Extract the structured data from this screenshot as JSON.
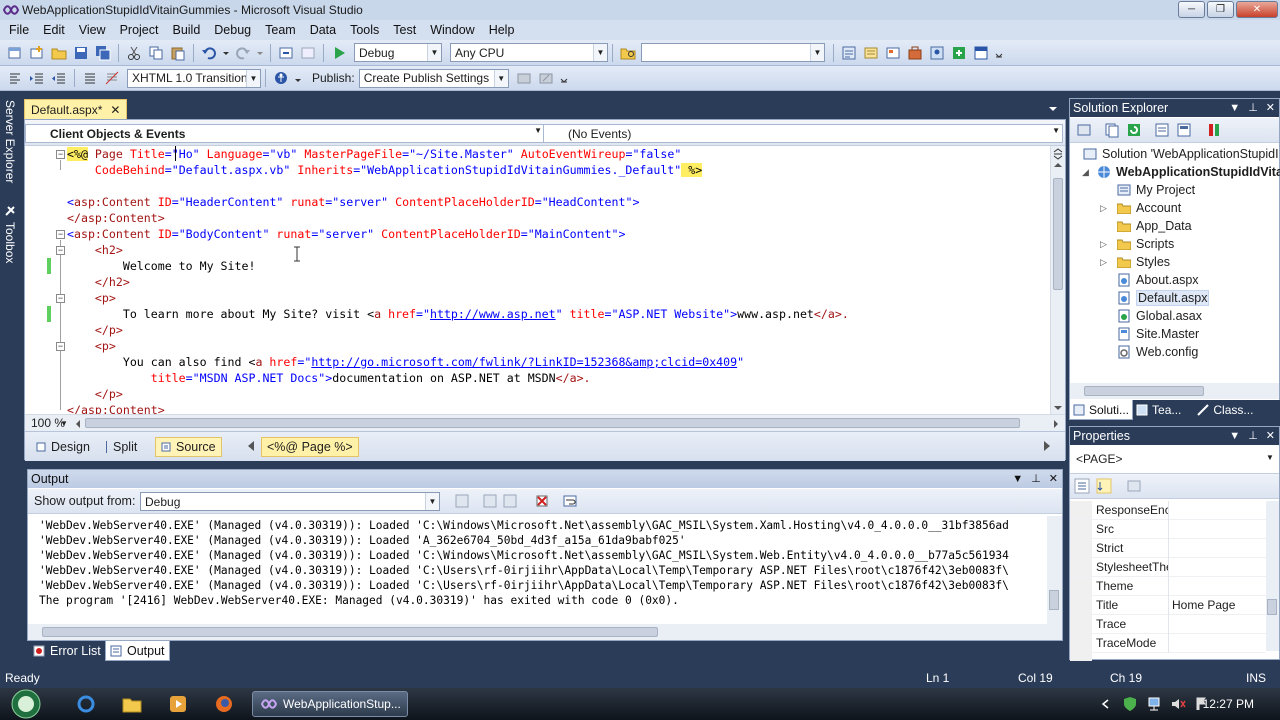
{
  "window": {
    "title": "WebApplicationStupidIdVitainGummies - Microsoft Visual Studio"
  },
  "menu": [
    "File",
    "Edit",
    "View",
    "Project",
    "Build",
    "Debug",
    "Team",
    "Data",
    "Tools",
    "Test",
    "Window",
    "Help"
  ],
  "toolbar1": {
    "config": "Debug",
    "platform": "Any CPU",
    "find_value": ""
  },
  "toolbar2": {
    "doctype": "XHTML 1.0 Transition",
    "publish_label": "Publish:",
    "publish_value": "Create Publish Settings"
  },
  "side_tabs": [
    "Server Explorer",
    "Toolbox"
  ],
  "editor": {
    "tab_label": "Default.aspx*",
    "nav_left": "Client Objects & Events",
    "nav_right": "(No Events)",
    "zoom": "100 %",
    "view_buttons": [
      "Design",
      "Split",
      "Source"
    ],
    "breadcrumb": "<%@ Page %>",
    "lines": {
      "l1a": "<%@",
      "l1b": " Page ",
      "l1c": "Title",
      "l1d": "=",
      "l1e": "\"Ho\"",
      "l1f": " Language",
      "l1g": "=\"vb\"",
      "l1h": " MasterPageFile",
      "l1i": "=\"~/Site.Master\"",
      "l1j": " AutoEventWireup",
      "l1k": "=\"false\"",
      "l2a": "    CodeBehind",
      "l2b": "=\"Default.aspx.vb\"",
      "l2c": " Inherits",
      "l2d": "=\"WebApplicationStupidIdVitainGummies._Default\"",
      "l2e": " %>",
      "l3a": "<",
      "l3b": "asp:Content",
      "l3c": " ID",
      "l3d": "=\"HeaderContent\"",
      "l3e": " runat",
      "l3f": "=\"server\"",
      "l3g": " ContentPlaceHolderID",
      "l3h": "=\"HeadContent\">",
      "l4": "</asp:Content>",
      "l5a": "<",
      "l5b": "asp:Content",
      "l5c": " ID",
      "l5d": "=\"BodyContent\"",
      "l5e": " runat",
      "l5f": "=\"server\"",
      "l5g": " ContentPlaceHolderID",
      "l5h": "=\"MainContent\">",
      "l6": "    <h2>",
      "l7": "        Welcome to My Site!",
      "l8": "    </h2>",
      "l9": "    <p>",
      "l10a": "        To learn more about My Site? visit <",
      "l10b": "a",
      "l10c": " href",
      "l10d": "=\"",
      "l10e": "http://www.asp.net",
      "l10f": "\"",
      "l10g": " title",
      "l10h": "=\"ASP.NET Website\">",
      "l10i": "www.asp.net",
      "l10j": "</a>.",
      "l11": "    </p>",
      "l12": "    <p>",
      "l13a": "        You can also find <",
      "l13b": "a",
      "l13c": " href",
      "l13d": "=\"",
      "l13e": "http://go.microsoft.com/fwlink/?LinkID=152368&amp;clcid=0x409",
      "l13f": "\"",
      "l14a": "            title",
      "l14b": "=\"MSDN ASP.NET Docs\">",
      "l14c": "documentation on ASP.NET at MSDN",
      "l14d": "</a>.",
      "l15": "    </p>",
      "l16": "</asp:Content>"
    }
  },
  "output": {
    "title": "Output",
    "show_from_label": "Show output from:",
    "show_from_value": "Debug",
    "lines": [
      "'WebDev.WebServer40.EXE' (Managed (v4.0.30319)): Loaded 'C:\\Windows\\Microsoft.Net\\assembly\\GAC_MSIL\\System.Xaml.Hosting\\v4.0_4.0.0.0__31bf3856ad",
      "'WebDev.WebServer40.EXE' (Managed (v4.0.30319)): Loaded 'A_362e6704_50bd_4d3f_a15a_61da9babf025'",
      "'WebDev.WebServer40.EXE' (Managed (v4.0.30319)): Loaded 'C:\\Windows\\Microsoft.Net\\assembly\\GAC_MSIL\\System.Web.Entity\\v4.0_4.0.0.0__b77a5c561934",
      "'WebDev.WebServer40.EXE' (Managed (v4.0.30319)): Loaded 'C:\\Users\\rf-0irjiihr\\AppData\\Local\\Temp\\Temporary ASP.NET Files\\root\\c1876f42\\3eb0083f\\",
      "'WebDev.WebServer40.EXE' (Managed (v4.0.30319)): Loaded 'C:\\Users\\rf-0irjiihr\\AppData\\Local\\Temp\\Temporary ASP.NET Files\\root\\c1876f42\\3eb0083f\\",
      "The program '[2416] WebDev.WebServer40.EXE: Managed (v4.0.30319)' has exited with code 0 (0x0)."
    ],
    "tabs": [
      "Error List",
      "Output"
    ]
  },
  "solution": {
    "title": "Solution Explorer",
    "root": "Solution 'WebApplicationStupidI",
    "project": "WebApplicationStupidIdVita",
    "items": [
      "My Project",
      "Account",
      "App_Data",
      "Scripts",
      "Styles",
      "About.aspx",
      "Default.aspx",
      "Global.asax",
      "Site.Master",
      "Web.config"
    ],
    "tabs": [
      "Soluti...",
      "Tea...",
      "Class..."
    ]
  },
  "properties": {
    "title": "Properties",
    "object": "<PAGE>",
    "rows": [
      {
        "k": "ResponseEnco",
        "v": ""
      },
      {
        "k": "Src",
        "v": ""
      },
      {
        "k": "Strict",
        "v": ""
      },
      {
        "k": "StylesheetThe",
        "v": ""
      },
      {
        "k": "Theme",
        "v": ""
      },
      {
        "k": "Title",
        "v": "Home Page"
      },
      {
        "k": "Trace",
        "v": ""
      },
      {
        "k": "TraceMode",
        "v": ""
      }
    ]
  },
  "status": {
    "ready": "Ready",
    "ln": "Ln 1",
    "col": "Col 19",
    "ch": "Ch 19",
    "ins": "INS"
  },
  "taskbar": {
    "task_label": "WebApplicationStup...",
    "time": "12:27 PM"
  }
}
